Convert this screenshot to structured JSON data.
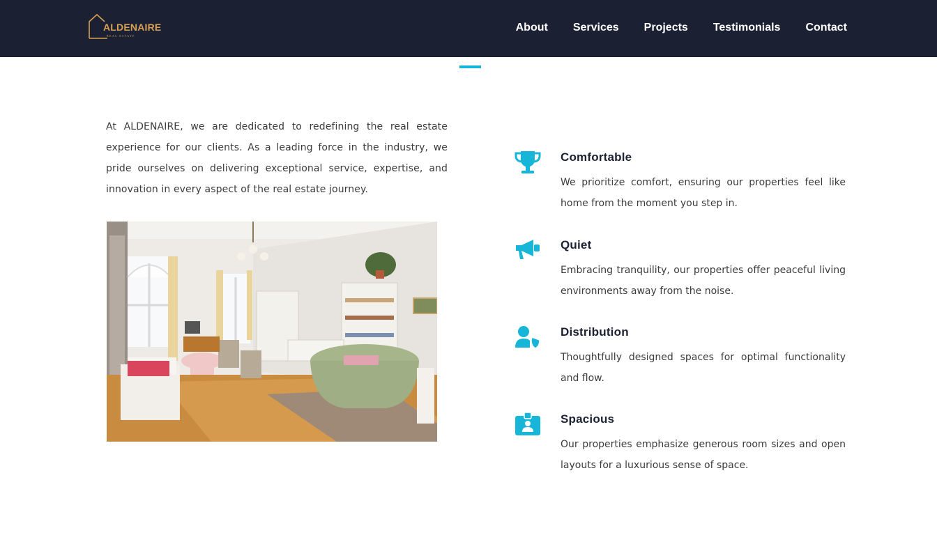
{
  "brand": {
    "name": "ALDENAIRE",
    "tagline": "REAL ESTATE",
    "accent_color": "#d7a055"
  },
  "nav": {
    "items": [
      "About",
      "Services",
      "Projects",
      "Testimonials",
      "Contact"
    ]
  },
  "theme": {
    "navbar_bg": "#1b2033",
    "accent": "#17b6d8"
  },
  "intro": {
    "text": "At ALDENAIRE, we are dedicated to redefining the real estate experience for our clients. As a leading force in the industry, we pride ourselves on delivering exceptional service, expertise, and innovation in every aspect of the real estate journey."
  },
  "photo": {
    "icon": "living-room-photo"
  },
  "features": [
    {
      "icon": "trophy-icon",
      "title": "Comfortable",
      "text": "We prioritize comfort, ensuring our properties feel like home from the moment you step in."
    },
    {
      "icon": "megaphone-icon",
      "title": "Quiet",
      "text": "Embracing tranquility, our properties offer peaceful living environments away from the noise."
    },
    {
      "icon": "user-shield-icon",
      "title": "Distribution",
      "text": "Thoughtfully designed spaces for optimal functionality and flow."
    },
    {
      "icon": "id-badge-icon",
      "title": "Spacious",
      "text": "Our properties emphasize generous room sizes and open layouts for a luxurious sense of space."
    }
  ]
}
